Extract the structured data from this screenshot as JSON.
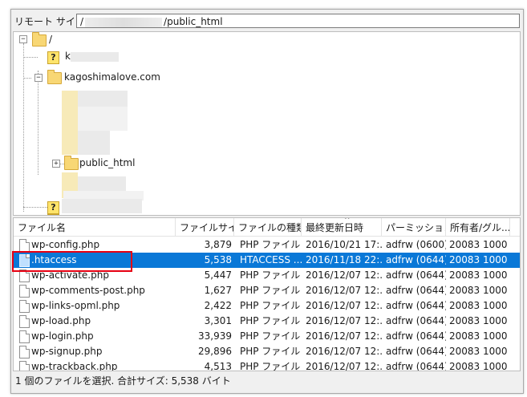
{
  "remote": {
    "label": "リモート サイト:",
    "path_prefix": "/",
    "path_suffix": "/public_html"
  },
  "tree": {
    "root": "/",
    "site": "kagoshimalove.com",
    "public_html": "public_html",
    "partial_letter": "k"
  },
  "filelist": {
    "columns": [
      "ファイル名",
      "ファイルサイズ",
      "ファイルの種類",
      "最終更新日時",
      "パーミッション",
      "所有者/グル..."
    ],
    "rows": [
      {
        "name": "wp-config.php",
        "size": "3,879",
        "type": "PHP ファイル",
        "modified": "2016/10/21 17:...",
        "perm": "adfrw (0600)",
        "owner": "20083 1000"
      },
      {
        "name": ".htaccess",
        "size": "5,538",
        "type": "HTACCESS ...",
        "modified": "2016/11/18 22:...",
        "perm": "adfrw (0644)",
        "owner": "20083 1000"
      },
      {
        "name": "wp-activate.php",
        "size": "5,447",
        "type": "PHP ファイル",
        "modified": "2016/12/07 12:...",
        "perm": "adfrw (0644)",
        "owner": "20083 1000"
      },
      {
        "name": "wp-comments-post.php",
        "size": "1,627",
        "type": "PHP ファイル",
        "modified": "2016/12/07 12:...",
        "perm": "adfrw (0644)",
        "owner": "20083 1000"
      },
      {
        "name": "wp-links-opml.php",
        "size": "2,422",
        "type": "PHP ファイル",
        "modified": "2016/12/07 12:...",
        "perm": "adfrw (0644)",
        "owner": "20083 1000"
      },
      {
        "name": "wp-load.php",
        "size": "3,301",
        "type": "PHP ファイル",
        "modified": "2016/12/07 12:...",
        "perm": "adfrw (0644)",
        "owner": "20083 1000"
      },
      {
        "name": "wp-login.php",
        "size": "33,939",
        "type": "PHP ファイル",
        "modified": "2016/12/07 12:...",
        "perm": "adfrw (0644)",
        "owner": "20083 1000"
      },
      {
        "name": "wp-signup.php",
        "size": "29,896",
        "type": "PHP ファイル",
        "modified": "2016/12/07 12:...",
        "perm": "adfrw (0644)",
        "owner": "20083 1000"
      },
      {
        "name": "wp-trackback.php",
        "size": "4,513",
        "type": "PHP ファイル",
        "modified": "2016/12/07 12:...",
        "perm": "adfrw (0644)",
        "owner": "20083 1000"
      }
    ],
    "selected_index": 1
  },
  "status": {
    "text": "1 個のファイルを選択. 合計サイズ: 5,538 バイト"
  },
  "colors": {
    "selection": "#0a78d7",
    "highlight": "#e60012",
    "folder": "#f8d775"
  },
  "icons": {
    "folder": "folder-icon",
    "unknown": "question-mark-icon",
    "file": "file-icon",
    "expand": "expand-icon",
    "collapse": "collapse-icon"
  }
}
